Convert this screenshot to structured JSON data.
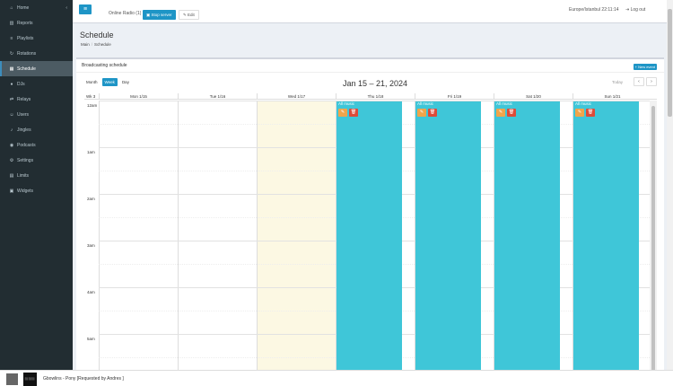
{
  "sidebar": {
    "items": [
      {
        "label": "Home",
        "icon": "home-icon",
        "glyph": "⌂",
        "chevron": "‹"
      },
      {
        "label": "Reports",
        "icon": "chart-icon",
        "glyph": "▥"
      },
      {
        "label": "Playlists",
        "icon": "list-icon",
        "glyph": "≡"
      },
      {
        "label": "Rotations",
        "icon": "rotate-icon",
        "glyph": "↻"
      },
      {
        "label": "Schedule",
        "icon": "calendar-icon",
        "glyph": "▦",
        "active": true
      },
      {
        "label": "DJs",
        "icon": "mic-icon",
        "glyph": "●"
      },
      {
        "label": "Relays",
        "icon": "relay-icon",
        "glyph": "⇄"
      },
      {
        "label": "Users",
        "icon": "users-icon",
        "glyph": "☺"
      },
      {
        "label": "Jingles",
        "icon": "bell-icon",
        "glyph": "♪"
      },
      {
        "label": "Podcasts",
        "icon": "podcast-icon",
        "glyph": "◉"
      },
      {
        "label": "Settings",
        "icon": "gear-icon",
        "glyph": "⚙"
      },
      {
        "label": "Limits",
        "icon": "limit-icon",
        "glyph": "▤"
      },
      {
        "label": "Widgets",
        "icon": "widget-icon",
        "glyph": "▣"
      }
    ]
  },
  "topbar": {
    "menu_glyph": "≡",
    "station": "Online Radio (1)",
    "stop_label": "▣ Stop server",
    "edit_label": "✎ Edit",
    "timezone": "Europe/Istanbul 22:11:14",
    "logout": "⇥ Log out"
  },
  "page": {
    "title": "Schedule",
    "breadcrumb": {
      "home": "Main",
      "sep": "/",
      "current": "Schedule"
    }
  },
  "calendar": {
    "box_title": "Broadcasting schedule",
    "new_event": "+ New event",
    "views": [
      "Month",
      "Week",
      "Day"
    ],
    "active_view": "Week",
    "title": "Jan 15 – 21, 2024",
    "today": "Today",
    "prev": "‹",
    "next": "›",
    "week_label": "Wk 3",
    "days": [
      "Mon 1/15",
      "Tue 1/16",
      "Wed 1/17",
      "Thu 1/18",
      "Fri 1/19",
      "Sat 1/20",
      "Sun 1/21"
    ],
    "today_index": 2,
    "hours": [
      "12am",
      "1am",
      "2am",
      "3am",
      "4am",
      "5am"
    ],
    "event_days": [
      3,
      4,
      5,
      6
    ],
    "event_title": "All music",
    "edit_glyph": "✎",
    "delete_glyph": "🗑",
    "event_color": "#3fc6d8"
  },
  "player": {
    "album_text": "⬛⬛⬛",
    "track": "Gbowlins - Pony [Requested by Andres ]"
  }
}
